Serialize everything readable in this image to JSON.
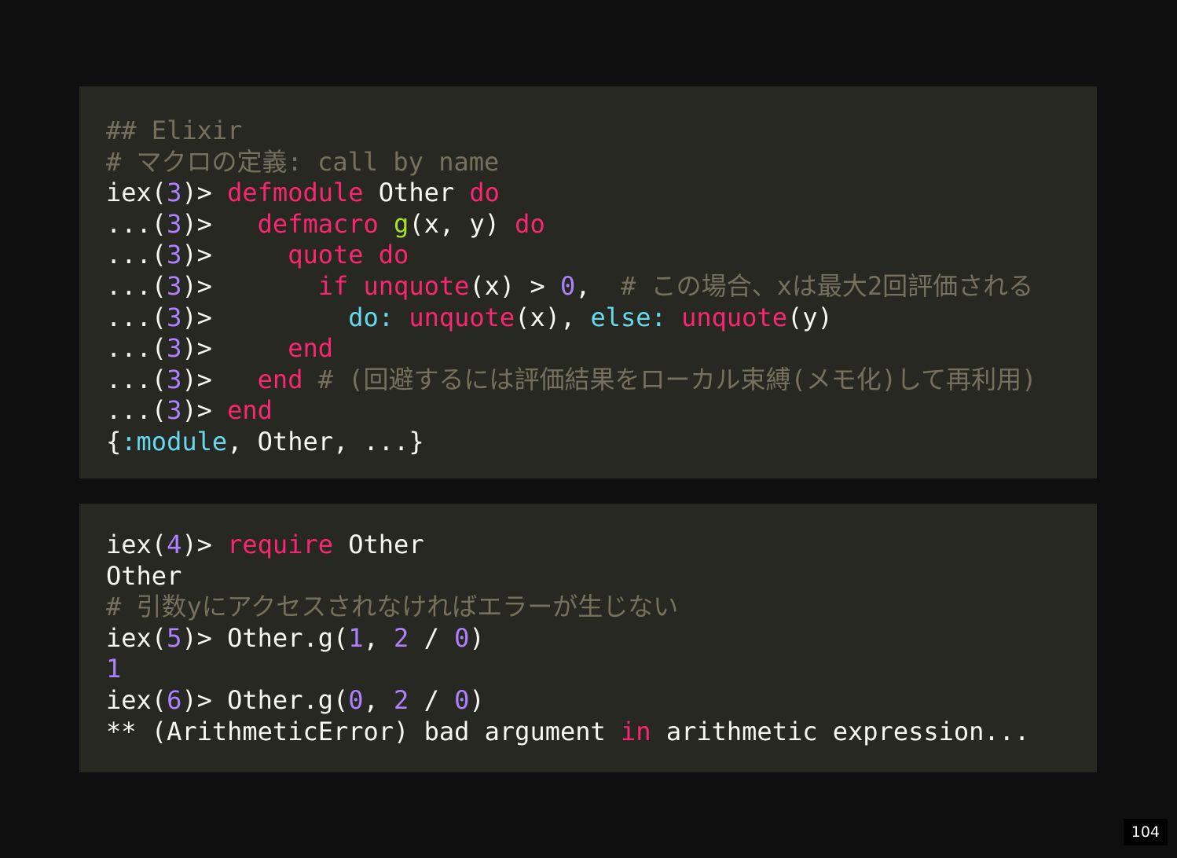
{
  "colors": {
    "background": "#0f0f0f",
    "code_bg": "#272822",
    "text": "#f8f8f2",
    "comment": "#75715e",
    "keyword": "#f92672",
    "number": "#ae81ff",
    "atom": "#66d9ef",
    "function": "#a6e22e"
  },
  "block1": [
    [
      {
        "t": "## Elixir",
        "c": "comment"
      }
    ],
    [
      {
        "t": "# マクロの定義: call by name",
        "c": "comment"
      }
    ],
    [
      {
        "t": "iex(",
        "c": "plain"
      },
      {
        "t": "3",
        "c": "num"
      },
      {
        "t": ")> ",
        "c": "plain"
      },
      {
        "t": "defmodule",
        "c": "kw"
      },
      {
        "t": " Other ",
        "c": "plain"
      },
      {
        "t": "do",
        "c": "kw"
      }
    ],
    [
      {
        "t": "...(",
        "c": "plain"
      },
      {
        "t": "3",
        "c": "num"
      },
      {
        "t": ")>   ",
        "c": "plain"
      },
      {
        "t": "defmacro",
        "c": "kw"
      },
      {
        "t": " ",
        "c": "plain"
      },
      {
        "t": "g",
        "c": "fn"
      },
      {
        "t": "(x, y) ",
        "c": "plain"
      },
      {
        "t": "do",
        "c": "kw"
      }
    ],
    [
      {
        "t": "...(",
        "c": "plain"
      },
      {
        "t": "3",
        "c": "num"
      },
      {
        "t": ")>     ",
        "c": "plain"
      },
      {
        "t": "quote do",
        "c": "kw"
      }
    ],
    [
      {
        "t": "...(",
        "c": "plain"
      },
      {
        "t": "3",
        "c": "num"
      },
      {
        "t": ")>       ",
        "c": "plain"
      },
      {
        "t": "if unquote",
        "c": "kw"
      },
      {
        "t": "(x) > ",
        "c": "plain"
      },
      {
        "t": "0",
        "c": "num"
      },
      {
        "t": ",  ",
        "c": "plain"
      },
      {
        "t": "# この場合、xは最大2回評価される",
        "c": "comment"
      }
    ],
    [
      {
        "t": "...(",
        "c": "plain"
      },
      {
        "t": "3",
        "c": "num"
      },
      {
        "t": ")>         ",
        "c": "plain"
      },
      {
        "t": "do:",
        "c": "atom"
      },
      {
        "t": " ",
        "c": "plain"
      },
      {
        "t": "unquote",
        "c": "kw"
      },
      {
        "t": "(x), ",
        "c": "plain"
      },
      {
        "t": "else:",
        "c": "atom"
      },
      {
        "t": " ",
        "c": "plain"
      },
      {
        "t": "unquote",
        "c": "kw"
      },
      {
        "t": "(y)",
        "c": "plain"
      }
    ],
    [
      {
        "t": "...(",
        "c": "plain"
      },
      {
        "t": "3",
        "c": "num"
      },
      {
        "t": ")>     ",
        "c": "plain"
      },
      {
        "t": "end",
        "c": "kw"
      }
    ],
    [
      {
        "t": "...(",
        "c": "plain"
      },
      {
        "t": "3",
        "c": "num"
      },
      {
        "t": ")>   ",
        "c": "plain"
      },
      {
        "t": "end",
        "c": "kw"
      },
      {
        "t": " # (回避するには評価結果をローカル束縛(メモ化)して再利用)",
        "c": "comment"
      }
    ],
    [
      {
        "t": "...(",
        "c": "plain"
      },
      {
        "t": "3",
        "c": "num"
      },
      {
        "t": ")> ",
        "c": "plain"
      },
      {
        "t": "end",
        "c": "kw"
      }
    ],
    [
      {
        "t": "{",
        "c": "plain"
      },
      {
        "t": ":module",
        "c": "atom"
      },
      {
        "t": ", Other, ...}",
        "c": "plain"
      }
    ]
  ],
  "block2": [
    [
      {
        "t": "iex(",
        "c": "plain"
      },
      {
        "t": "4",
        "c": "num"
      },
      {
        "t": ")> ",
        "c": "plain"
      },
      {
        "t": "require",
        "c": "kw"
      },
      {
        "t": " Other",
        "c": "plain"
      }
    ],
    [
      {
        "t": "Other",
        "c": "plain"
      }
    ],
    [
      {
        "t": "# 引数yにアクセスされなければエラーが生じない",
        "c": "comment"
      }
    ],
    [
      {
        "t": "iex(",
        "c": "plain"
      },
      {
        "t": "5",
        "c": "num"
      },
      {
        "t": ")> Other.g(",
        "c": "plain"
      },
      {
        "t": "1",
        "c": "num"
      },
      {
        "t": ", ",
        "c": "plain"
      },
      {
        "t": "2",
        "c": "num"
      },
      {
        "t": " / ",
        "c": "plain"
      },
      {
        "t": "0",
        "c": "num"
      },
      {
        "t": ")",
        "c": "plain"
      }
    ],
    [
      {
        "t": "1",
        "c": "num"
      }
    ],
    [
      {
        "t": "iex(",
        "c": "plain"
      },
      {
        "t": "6",
        "c": "num"
      },
      {
        "t": ")> Other.g(",
        "c": "plain"
      },
      {
        "t": "0",
        "c": "num"
      },
      {
        "t": ", ",
        "c": "plain"
      },
      {
        "t": "2",
        "c": "num"
      },
      {
        "t": " / ",
        "c": "plain"
      },
      {
        "t": "0",
        "c": "num"
      },
      {
        "t": ")",
        "c": "plain"
      }
    ],
    [
      {
        "t": "** (ArithmeticError) bad argument ",
        "c": "plain"
      },
      {
        "t": "in",
        "c": "kw"
      },
      {
        "t": " arithmetic expression...",
        "c": "plain"
      }
    ]
  ],
  "page_number": "104"
}
